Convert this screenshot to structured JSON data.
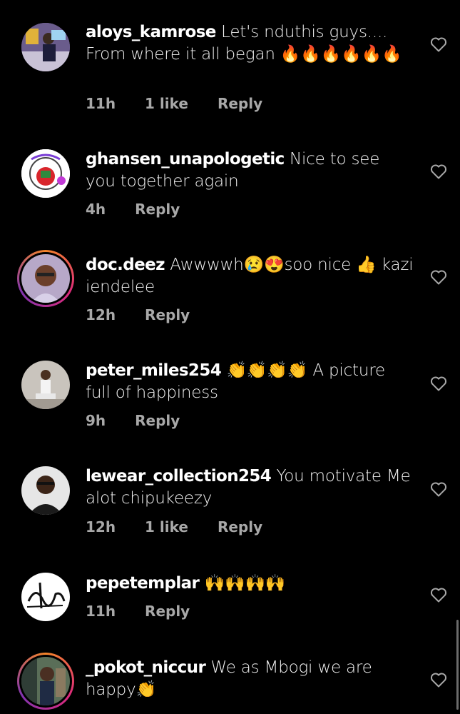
{
  "comments": [
    {
      "username": "aloys_kamrose",
      "text": "Let's nduthis guys.... From where it all began 🔥🔥🔥🔥🔥🔥",
      "time": "11h",
      "likes": "1 like",
      "reply": "Reply",
      "story_ring": false,
      "avatar": "avatar-photo"
    },
    {
      "username": "ghansen_unapologetic",
      "text": "Nice to see you together again",
      "time": "4h",
      "likes": "",
      "reply": "Reply",
      "story_ring": false,
      "avatar": "avatar-logo"
    },
    {
      "username": "doc.deez",
      "text": "Awwwwh😢😍soo nice 👍 kazi iendelee",
      "time": "12h",
      "likes": "",
      "reply": "Reply",
      "story_ring": true,
      "avatar": "avatar-photo"
    },
    {
      "username": "peter_miles254",
      "text": "👏👏👏👏 A picture full of happiness",
      "time": "9h",
      "likes": "",
      "reply": "Reply",
      "story_ring": false,
      "avatar": "avatar-photo"
    },
    {
      "username": "lewear_collection254",
      "text": "You motivate Me alot chipukeezy",
      "time": "12h",
      "likes": "1 like",
      "reply": "Reply",
      "story_ring": false,
      "avatar": "avatar-photo"
    },
    {
      "username": "pepetemplar",
      "text": "🙌🙌🙌🙌",
      "time": "11h",
      "likes": "",
      "reply": "Reply",
      "story_ring": false,
      "avatar": "avatar-signature"
    },
    {
      "username": "_pokot_niccur",
      "text": "We as Mbogi we are happy👏",
      "time": "",
      "likes": "",
      "reply": "",
      "story_ring": true,
      "avatar": "avatar-photo"
    }
  ],
  "icons": {
    "like": "heart-outline-icon"
  },
  "colors": {
    "background": "#000000",
    "meta": "#a8a8a8",
    "text": "#ffffff"
  }
}
